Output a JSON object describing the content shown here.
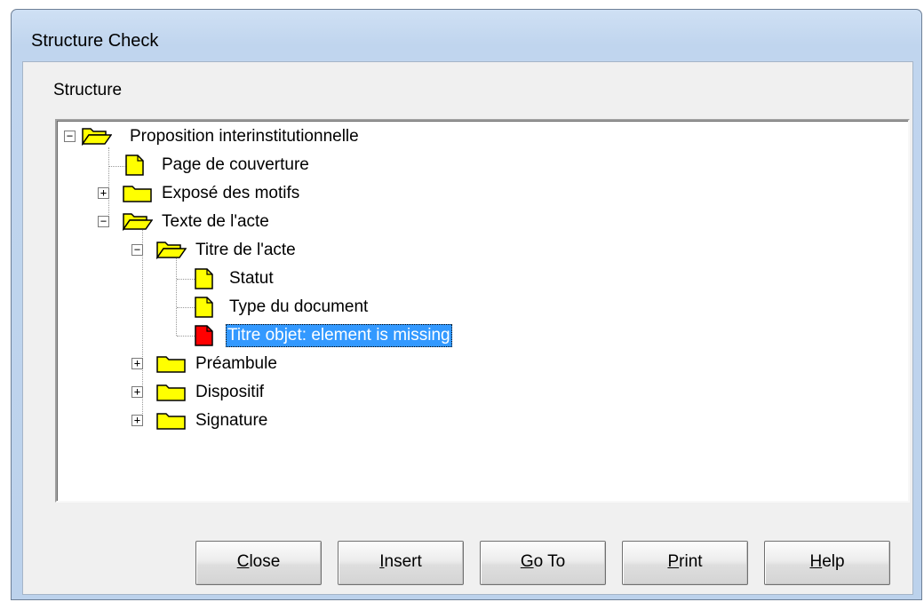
{
  "window": {
    "title": "Structure Check"
  },
  "group": {
    "label": "Structure"
  },
  "tree": {
    "root": "Proposition interinstitutionnelle",
    "page_couverture": "Page de couverture",
    "expose_motifs": "Exposé des motifs",
    "texte_acte": "Texte de l'acte",
    "titre_acte": "Titre de l'acte",
    "statut": "Statut",
    "type_document": "Type du document",
    "titre_objet": "Titre objet: element is missing",
    "preambule": "Préambule",
    "dispositif": "Dispositif",
    "signature": "Signature"
  },
  "buttons": {
    "close": {
      "mnemonic": "C",
      "rest": "lose"
    },
    "insert": {
      "mnemonic": "I",
      "rest": "nsert"
    },
    "goto": {
      "mnemonic": "G",
      "rest": "o To"
    },
    "print": {
      "mnemonic": "P",
      "rest": "rint"
    },
    "help": {
      "mnemonic": "H",
      "rest": "elp"
    }
  },
  "colors": {
    "folder": "#ffff00",
    "document": "#ffff00",
    "missing_document": "#ff0000",
    "selection": "#3399ff"
  },
  "icons": {
    "open_folder": "folder-open-icon",
    "closed_folder": "folder-icon",
    "document": "document-icon",
    "error_document": "missing-document-icon"
  }
}
